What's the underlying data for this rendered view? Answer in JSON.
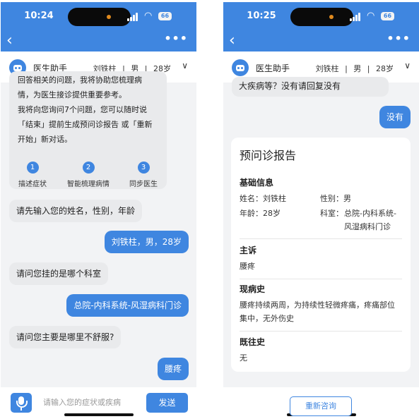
{
  "left": {
    "time": "10:24",
    "battery": "66",
    "assistant_name": "医生助手",
    "patient": {
      "name": "刘铁柱",
      "gender": "男",
      "age": "28岁"
    },
    "intro_lines": [
      "回答相关的问题，我将协助您梳理病",
      "情，为医生接诊提供重要参考。",
      "我将向您询问7个问题，您可以随时说",
      "「结束」提前生成预问诊报告 或「重新",
      "开始」新对话。"
    ],
    "steps": [
      {
        "num": "1",
        "label": "描述症状"
      },
      {
        "num": "2",
        "label": "智能梳理病情"
      },
      {
        "num": "3",
        "label": "同步医生"
      }
    ],
    "messages": [
      {
        "from": "bot",
        "text": "请先输入您的姓名，性别，年龄"
      },
      {
        "from": "me",
        "text": "刘铁柱，男，28岁"
      },
      {
        "from": "bot",
        "text": "请问您挂的是哪个科室"
      },
      {
        "from": "me",
        "text": "总院-内科系统-风湿病科门诊"
      },
      {
        "from": "bot",
        "text": "请问您主要是哪里不舒服?"
      },
      {
        "from": "me",
        "text": "腰疼"
      }
    ],
    "input_placeholder": "请输入您的症状或疾病",
    "send_label": "发送"
  },
  "right": {
    "time": "10:25",
    "battery": "66",
    "assistant_name": "医生助手",
    "patient": {
      "name": "刘铁柱",
      "gender": "男",
      "age": "28岁"
    },
    "partial_message": "大疾病等？没有请回复没有",
    "reply": "没有",
    "report": {
      "title": "预问诊报告",
      "basic_title": "基础信息",
      "name_text": "姓名：刘铁柱",
      "gender_text": "性别：男",
      "age_text": "年龄：28岁",
      "dept_label": "科室：",
      "dept_line1": "总院-内科系统-",
      "dept_line2": "风湿病科门诊",
      "chief_title": "主诉",
      "chief_text": "腰疼",
      "present_title": "现病史",
      "present_line1": "腰疼持续两周，为持续性轻微疼痛，疼痛部位",
      "present_line2": "集中，无外伤史",
      "past_title": "既往史",
      "past_text": "无"
    },
    "restart_label": "重新咨询"
  },
  "colors": {
    "accent": "#3f86e0",
    "bot_bubble": "#e9eaec",
    "background": "#f2f3f5"
  }
}
